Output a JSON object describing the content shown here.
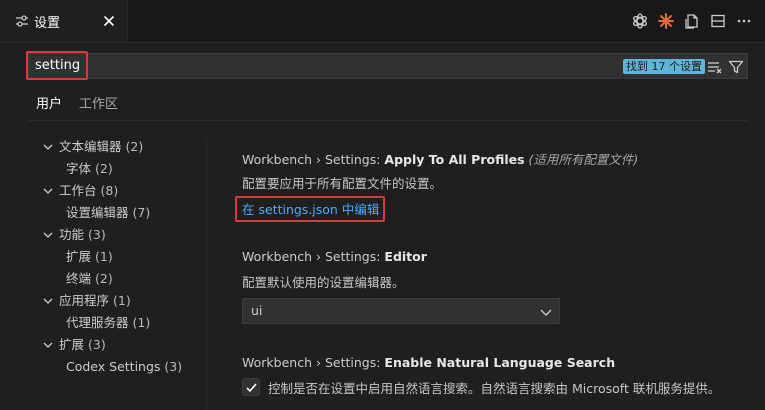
{
  "tab": {
    "label": "设置"
  },
  "search": {
    "value": "setting",
    "result_count": "找到 17 个设置"
  },
  "scope_tabs": [
    {
      "label": "用户"
    },
    {
      "label": "工作区"
    }
  ],
  "toc": [
    {
      "label": "文本编辑器",
      "count": "(2)"
    },
    {
      "label": "字体",
      "count": "(2)"
    },
    {
      "label": "工作台",
      "count": "(8)"
    },
    {
      "label": "设置编辑器",
      "count": "(7)"
    },
    {
      "label": "功能",
      "count": "(3)"
    },
    {
      "label": "扩展",
      "count": "(1)"
    },
    {
      "label": "终端",
      "count": "(2)"
    },
    {
      "label": "应用程序",
      "count": "(1)"
    },
    {
      "label": "代理服务器",
      "count": "(1)"
    },
    {
      "label": "扩展",
      "count": "(3)"
    },
    {
      "label": "Codex Settings",
      "count": "(3)"
    }
  ],
  "settings": {
    "s1": {
      "category": "Workbench › Settings: ",
      "name": "Apply To All Profiles",
      "note": " (适用所有配置文件)",
      "desc": "配置要应用于所有配置文件的设置。",
      "link": "在 settings.json 中编辑"
    },
    "s2": {
      "category": "Workbench › Settings: ",
      "name": "Editor",
      "desc": "配置默认使用的设置编辑器。",
      "value": "ui"
    },
    "s3": {
      "category": "Workbench › Settings: ",
      "name": "Enable Natural Language Search",
      "desc": "控制是否在设置中启用自然语言搜索。自然语言搜索由 Microsoft 联机服务提供。",
      "checked": true
    }
  },
  "colors": {
    "background": "#1f1f1f",
    "link": "#4daafc",
    "highlight_box": "#e0343f",
    "count_badge": "#5db6d7",
    "accent_orange": "#e46a3a"
  },
  "icons": {
    "tab": "settings-sliders-icon",
    "close": "close-icon",
    "actions": [
      "openai-icon",
      "sparkle-icon",
      "open-settings-json-icon",
      "split-editor-icon",
      "more-icon"
    ],
    "search": [
      "clear-filter-icon",
      "filter-icon"
    ]
  }
}
